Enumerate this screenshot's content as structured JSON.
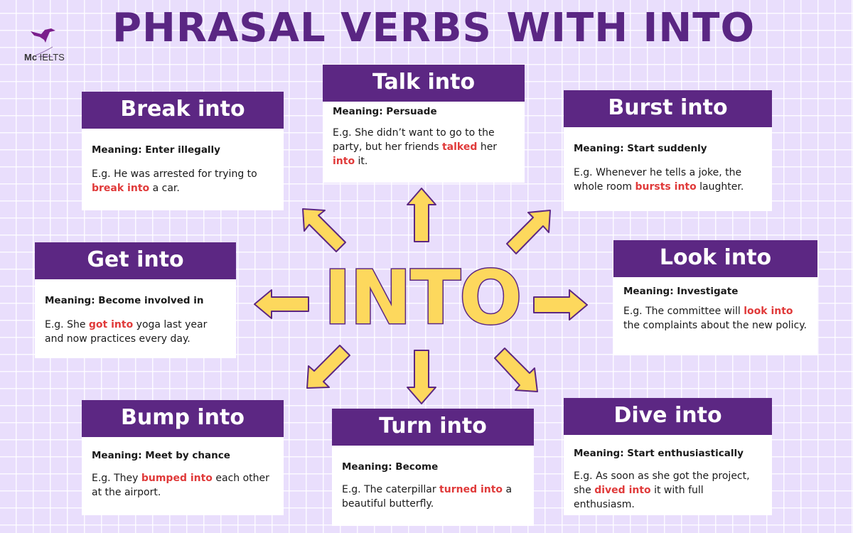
{
  "title": "PHRASAL VERBS WITH INTO",
  "logo": {
    "brand_bold": "Mc",
    "brand_light": " IELTS",
    "icon": "hummingbird-icon"
  },
  "center_word": "INTO",
  "colors": {
    "purple": "#5c2783",
    "yellow": "#fdd85d",
    "highlight": "#e03a3a",
    "background": "#e9defc"
  },
  "cards": [
    {
      "id": "break-into",
      "heading": "Break into",
      "meaning": "Meaning: Enter illegally",
      "example": [
        {
          "t": "E.g. He was arrested for trying to "
        },
        {
          "t": "break into",
          "hl": true
        },
        {
          "t": " a car."
        }
      ]
    },
    {
      "id": "talk-into",
      "heading": "Talk into",
      "meaning": "Meaning: Persuade",
      "example": [
        {
          "t": "E.g. She didn’t want to go to the party, but her friends "
        },
        {
          "t": "talked",
          "hl": true
        },
        {
          "t": " her "
        },
        {
          "t": "into",
          "hl": true
        },
        {
          "t": " it."
        }
      ]
    },
    {
      "id": "burst-into",
      "heading": "Burst into",
      "meaning": "Meaning: Start suddenly",
      "example": [
        {
          "t": "E.g. Whenever he tells a joke, the whole room "
        },
        {
          "t": "bursts into",
          "hl": true
        },
        {
          "t": " laughter."
        }
      ]
    },
    {
      "id": "get-into",
      "heading": "Get into",
      "meaning": "Meaning: Become involved in",
      "example": [
        {
          "t": "E.g. She "
        },
        {
          "t": "got into",
          "hl": true
        },
        {
          "t": " yoga last year and now practices every day."
        }
      ]
    },
    {
      "id": "look-into",
      "heading": "Look into",
      "meaning": "Meaning: Investigate",
      "example": [
        {
          "t": "E.g. The committee will "
        },
        {
          "t": "look into",
          "hl": true
        },
        {
          "t": " the complaints about the new policy."
        }
      ]
    },
    {
      "id": "bump-into",
      "heading": "Bump into",
      "meaning": "Meaning: Meet by chance",
      "example": [
        {
          "t": "E.g. They "
        },
        {
          "t": "bumped into",
          "hl": true
        },
        {
          "t": " each other at the airport."
        }
      ]
    },
    {
      "id": "turn-into",
      "heading": "Turn into",
      "meaning": "Meaning: Become",
      "example": [
        {
          "t": "E.g. The caterpillar "
        },
        {
          "t": "turned into",
          "hl": true
        },
        {
          "t": " a beautiful butterfly."
        }
      ]
    },
    {
      "id": "dive-into",
      "heading": "Dive into",
      "meaning": "Meaning: Start enthusiastically",
      "example": [
        {
          "t": "E.g. As soon as she got the project, she "
        },
        {
          "t": "dived into",
          "hl": true
        },
        {
          "t": " it with full enthusiasm."
        }
      ]
    }
  ]
}
